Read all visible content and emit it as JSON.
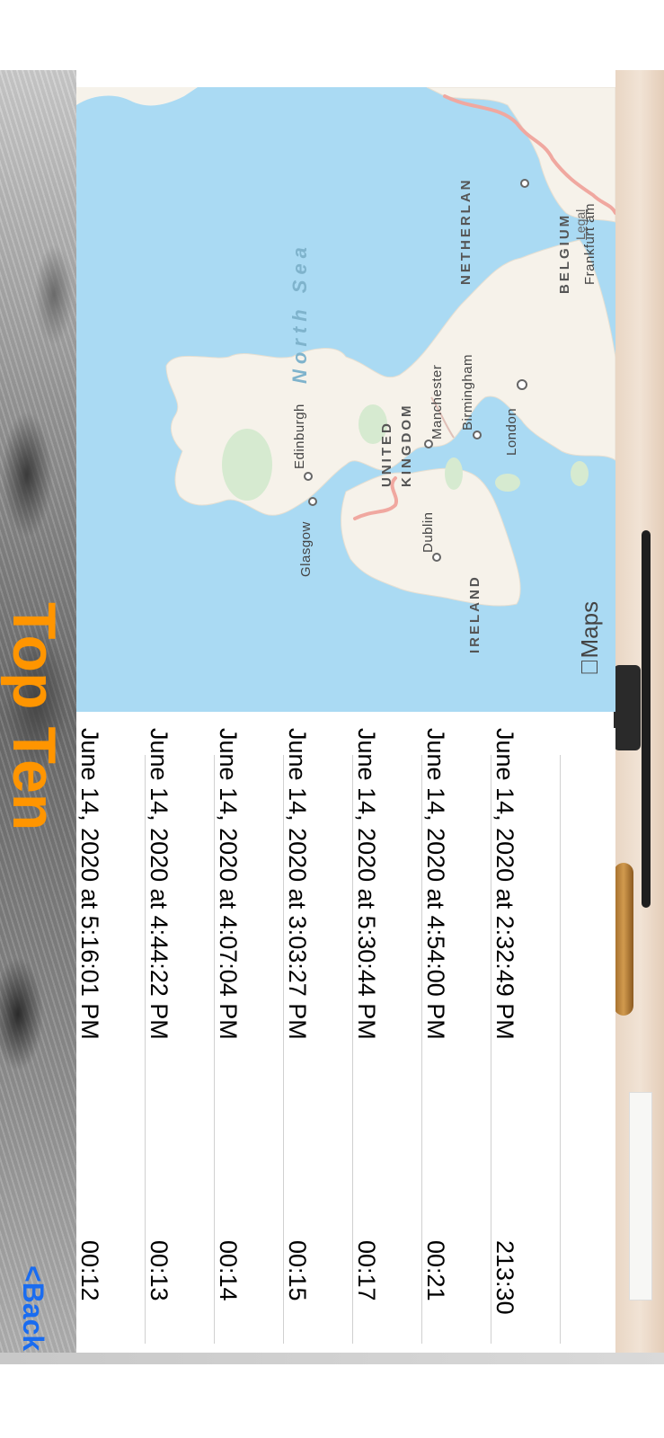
{
  "nav": {
    "title": "Top Ten",
    "back_label": "<Back"
  },
  "colors": {
    "title": "#ff9500",
    "back": "#1a6cf0",
    "water": "#aadaf3",
    "land": "#f6f2ea"
  },
  "map": {
    "provider_label": "Maps",
    "legal_label": "Legal",
    "sea_label": "North Sea",
    "countries": [
      "UNITED KINGDOM",
      "IRELAND",
      "NETHERLAN",
      "BELGIUM"
    ],
    "cities": [
      "Edinburgh",
      "Glasgow",
      "Manchester",
      "Birmingham",
      "London",
      "Dublin",
      "Frankfurt am"
    ]
  },
  "scores": [
    {
      "time": "00:12",
      "date": "June 14, 2020 at 5:16:01 PM"
    },
    {
      "time": "00:13",
      "date": "June 14, 2020 at 4:44:22 PM"
    },
    {
      "time": "00:14",
      "date": "June 14, 2020 at 4:07:04 PM"
    },
    {
      "time": "00:15",
      "date": "June 14, 2020 at 3:03:27 PM"
    },
    {
      "time": "00:17",
      "date": "June 14, 2020 at 5:30:44 PM"
    },
    {
      "time": "00:21",
      "date": "June 14, 2020 at 4:54:00 PM"
    },
    {
      "time": "213:30",
      "date": "June 14, 2020 at 2:32:49 PM"
    }
  ]
}
